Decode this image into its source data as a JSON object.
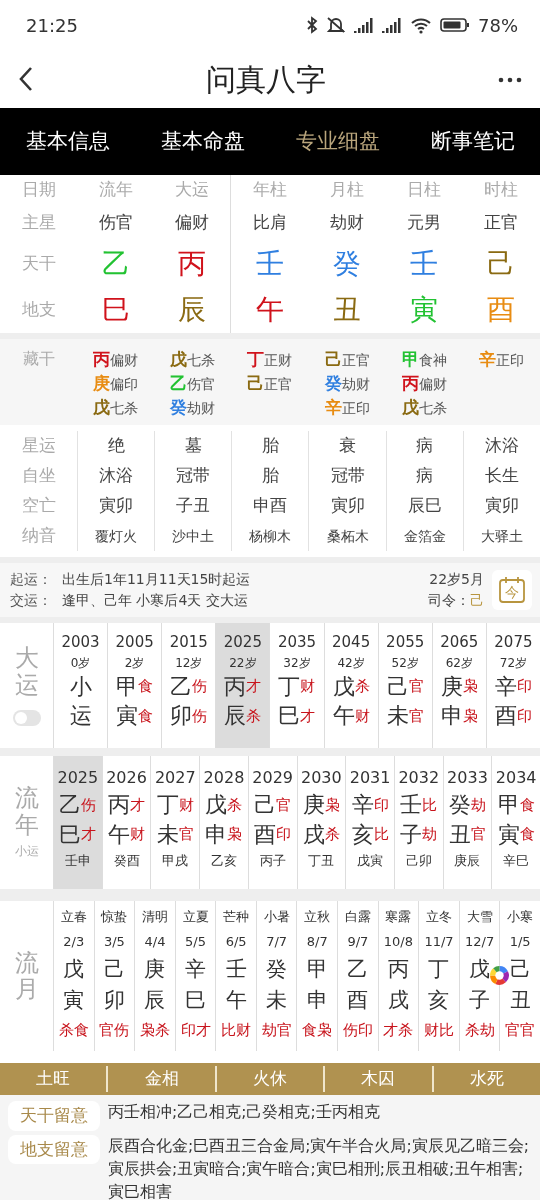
{
  "status_bar": {
    "time": "21:25",
    "battery": "78%"
  },
  "header": {
    "title": "问真八字"
  },
  "tabs": [
    {
      "label": "基本信息",
      "selected": false
    },
    {
      "label": "基本命盘",
      "selected": false
    },
    {
      "label": "专业细盘",
      "selected": true
    },
    {
      "label": "断事笔记",
      "selected": false
    }
  ],
  "pillars": {
    "row_labels": [
      "日期",
      "主星",
      "天干",
      "地支"
    ],
    "columns": [
      {
        "heading": "流年",
        "star": "伤官",
        "stem": {
          "char": "乙",
          "color": "#22c232"
        },
        "branch": {
          "char": "巳",
          "color": "#d0121b"
        }
      },
      {
        "heading": "大运",
        "star": "偏财",
        "stem": {
          "char": "丙",
          "color": "#d0121b"
        },
        "branch": {
          "char": "辰",
          "color": "#8a6a12"
        }
      },
      {
        "heading": "年柱",
        "star": "比肩",
        "stem": {
          "char": "壬",
          "color": "#2f7fe0"
        },
        "branch": {
          "char": "午",
          "color": "#d0121b"
        }
      },
      {
        "heading": "月柱",
        "star": "劫财",
        "stem": {
          "char": "癸",
          "color": "#2f7fe0"
        },
        "branch": {
          "char": "丑",
          "color": "#8a6a12"
        }
      },
      {
        "heading": "日柱",
        "star": "元男",
        "stem": {
          "char": "壬",
          "color": "#2f7fe0"
        },
        "branch": {
          "char": "寅",
          "color": "#22c232"
        }
      },
      {
        "heading": "时柱",
        "star": "正官",
        "stem": {
          "char": "己",
          "color": "#8a6a12"
        },
        "branch": {
          "char": "酉",
          "color": "#e88c12"
        }
      }
    ]
  },
  "hidden_stems": {
    "label": "藏干",
    "columns": [
      [
        {
          "stem": "丙",
          "color": "#d0121b",
          "god": "偏财"
        },
        {
          "stem": "庚",
          "color": "#e88c12",
          "god": "偏印"
        },
        {
          "stem": "戊",
          "color": "#8a6a12",
          "god": "七杀"
        }
      ],
      [
        {
          "stem": "戊",
          "color": "#8a6a12",
          "god": "七杀"
        },
        {
          "stem": "乙",
          "color": "#22c232",
          "god": "伤官"
        },
        {
          "stem": "癸",
          "color": "#2f7fe0",
          "god": "劫财"
        }
      ],
      [
        {
          "stem": "丁",
          "color": "#d0121b",
          "god": "正财"
        },
        {
          "stem": "己",
          "color": "#8a6a12",
          "god": "正官"
        }
      ],
      [
        {
          "stem": "己",
          "color": "#8a6a12",
          "god": "正官"
        },
        {
          "stem": "癸",
          "color": "#2f7fe0",
          "god": "劫财"
        },
        {
          "stem": "辛",
          "color": "#e88c12",
          "god": "正印"
        }
      ],
      [
        {
          "stem": "甲",
          "color": "#22c232",
          "god": "食神"
        },
        {
          "stem": "丙",
          "color": "#d0121b",
          "god": "偏财"
        },
        {
          "stem": "戊",
          "color": "#8a6a12",
          "god": "七杀"
        }
      ],
      [
        {
          "stem": "辛",
          "color": "#e88c12",
          "god": "正印"
        }
      ]
    ]
  },
  "stages": [
    {
      "label": "星运",
      "values": [
        "绝",
        "墓",
        "胎",
        "衰",
        "病",
        "沐浴"
      ]
    },
    {
      "label": "自坐",
      "values": [
        "沐浴",
        "冠带",
        "胎",
        "冠带",
        "病",
        "长生"
      ]
    },
    {
      "label": "空亡",
      "values": [
        "寅卯",
        "子丑",
        "申酉",
        "寅卯",
        "辰巳",
        "寅卯"
      ]
    },
    {
      "label": "纳音",
      "values": [
        "覆灯火",
        "沙中土",
        "杨柳木",
        "桑柘木",
        "金箔金",
        "大驿土"
      ]
    }
  ],
  "qiyun": {
    "lines": [
      {
        "label": "起运：",
        "text": "出生后1年11月11天15时起运"
      },
      {
        "label": "交运：",
        "text": "逢甲、己年 小寒后4天 交大运"
      }
    ],
    "age": "22岁5月",
    "siling_label": "司令：",
    "siling": "己",
    "calendar_button": "今"
  },
  "dayun": {
    "label": "大运",
    "toggle": {
      "on": false
    },
    "items": [
      {
        "year": "2003",
        "age": "0岁",
        "stem": "小",
        "branch": "运",
        "selected": false
      },
      {
        "year": "2005",
        "age": "2岁",
        "stem": "甲",
        "stem_god": "食",
        "branch": "寅",
        "branch_god": "食",
        "selected": false
      },
      {
        "year": "2015",
        "age": "12岁",
        "stem": "乙",
        "stem_god": "伤",
        "branch": "卯",
        "branch_god": "伤",
        "selected": false
      },
      {
        "year": "2025",
        "age": "22岁",
        "stem": "丙",
        "stem_god": "才",
        "branch": "辰",
        "branch_god": "杀",
        "selected": true
      },
      {
        "year": "2035",
        "age": "32岁",
        "stem": "丁",
        "stem_god": "财",
        "branch": "巳",
        "branch_god": "才",
        "selected": false
      },
      {
        "year": "2045",
        "age": "42岁",
        "stem": "戊",
        "stem_god": "杀",
        "branch": "午",
        "branch_god": "财",
        "selected": false
      },
      {
        "year": "2055",
        "age": "52岁",
        "stem": "己",
        "stem_god": "官",
        "branch": "未",
        "branch_god": "官",
        "selected": false
      },
      {
        "year": "2065",
        "age": "62岁",
        "stem": "庚",
        "stem_god": "枭",
        "branch": "申",
        "branch_god": "枭",
        "selected": false
      },
      {
        "year": "2075",
        "age": "72岁",
        "stem": "辛",
        "stem_god": "印",
        "branch": "酉",
        "branch_god": "印",
        "selected": false
      }
    ]
  },
  "liunian": {
    "label": "流年",
    "sublabel": "小运",
    "items": [
      {
        "year": "2025",
        "stem": "乙",
        "stem_god": "伤",
        "branch": "巳",
        "branch_god": "才",
        "xiaoyun": "壬申",
        "selected": true
      },
      {
        "year": "2026",
        "stem": "丙",
        "stem_god": "才",
        "branch": "午",
        "branch_god": "财",
        "xiaoyun": "癸酉",
        "selected": false
      },
      {
        "year": "2027",
        "stem": "丁",
        "stem_god": "财",
        "branch": "未",
        "branch_god": "官",
        "xiaoyun": "甲戌",
        "selected": false
      },
      {
        "year": "2028",
        "stem": "戊",
        "stem_god": "杀",
        "branch": "申",
        "branch_god": "枭",
        "xiaoyun": "乙亥",
        "selected": false
      },
      {
        "year": "2029",
        "stem": "己",
        "stem_god": "官",
        "branch": "酉",
        "branch_god": "印",
        "xiaoyun": "丙子",
        "selected": false
      },
      {
        "year": "2030",
        "stem": "庚",
        "stem_god": "枭",
        "branch": "戌",
        "branch_god": "杀",
        "xiaoyun": "丁丑",
        "selected": false
      },
      {
        "year": "2031",
        "stem": "辛",
        "stem_god": "印",
        "branch": "亥",
        "branch_god": "比",
        "xiaoyun": "戊寅",
        "selected": false
      },
      {
        "year": "2032",
        "stem": "壬",
        "stem_god": "比",
        "branch": "子",
        "branch_god": "劫",
        "xiaoyun": "己卯",
        "selected": false
      },
      {
        "year": "2033",
        "stem": "癸",
        "stem_god": "劫",
        "branch": "丑",
        "branch_god": "官",
        "xiaoyun": "庚辰",
        "selected": false
      },
      {
        "year": "2034",
        "stem": "甲",
        "stem_god": "食",
        "branch": "寅",
        "branch_god": "食",
        "xiaoyun": "辛巳",
        "selected": false
      }
    ]
  },
  "liuyue": {
    "label": "流月",
    "items": [
      {
        "term": "立春",
        "date": "2/3",
        "stem": "戊",
        "branch": "寅",
        "gods": "杀食"
      },
      {
        "term": "惊蛰",
        "date": "3/5",
        "stem": "己",
        "branch": "卯",
        "gods": "官伤"
      },
      {
        "term": "清明",
        "date": "4/4",
        "stem": "庚",
        "branch": "辰",
        "gods": "枭杀"
      },
      {
        "term": "立夏",
        "date": "5/5",
        "stem": "辛",
        "branch": "巳",
        "gods": "印才"
      },
      {
        "term": "芒种",
        "date": "6/5",
        "stem": "壬",
        "branch": "午",
        "gods": "比财"
      },
      {
        "term": "小暑",
        "date": "7/7",
        "stem": "癸",
        "branch": "未",
        "gods": "劫官"
      },
      {
        "term": "立秋",
        "date": "8/7",
        "stem": "甲",
        "branch": "申",
        "gods": "食枭"
      },
      {
        "term": "白露",
        "date": "9/7",
        "stem": "乙",
        "branch": "酉",
        "gods": "伤印"
      },
      {
        "term": "寒露",
        "date": "10/8",
        "stem": "丙",
        "branch": "戌",
        "gods": "才杀"
      },
      {
        "term": "立冬",
        "date": "11/7",
        "stem": "丁",
        "branch": "亥",
        "gods": "财比"
      },
      {
        "term": "大雪",
        "date": "12/7",
        "stem": "戊",
        "branch": "子",
        "gods": "杀劫"
      },
      {
        "term": "小寒",
        "date": "1/5",
        "stem": "己",
        "branch": "丑",
        "gods": "官官"
      }
    ]
  },
  "seasons": [
    "土旺",
    "金相",
    "火休",
    "木囚",
    "水死"
  ],
  "notes": [
    {
      "label": "天干留意",
      "text": "丙壬相冲;乙己相克;己癸相克;壬丙相克"
    },
    {
      "label": "地支留意",
      "text": "辰酉合化金;巳酉丑三合金局;寅午半合火局;寅辰见乙暗三会;寅辰拱会;丑寅暗合;寅午暗合;寅巳相刑;辰丑相破;丑午相害;寅巳相害"
    }
  ]
}
